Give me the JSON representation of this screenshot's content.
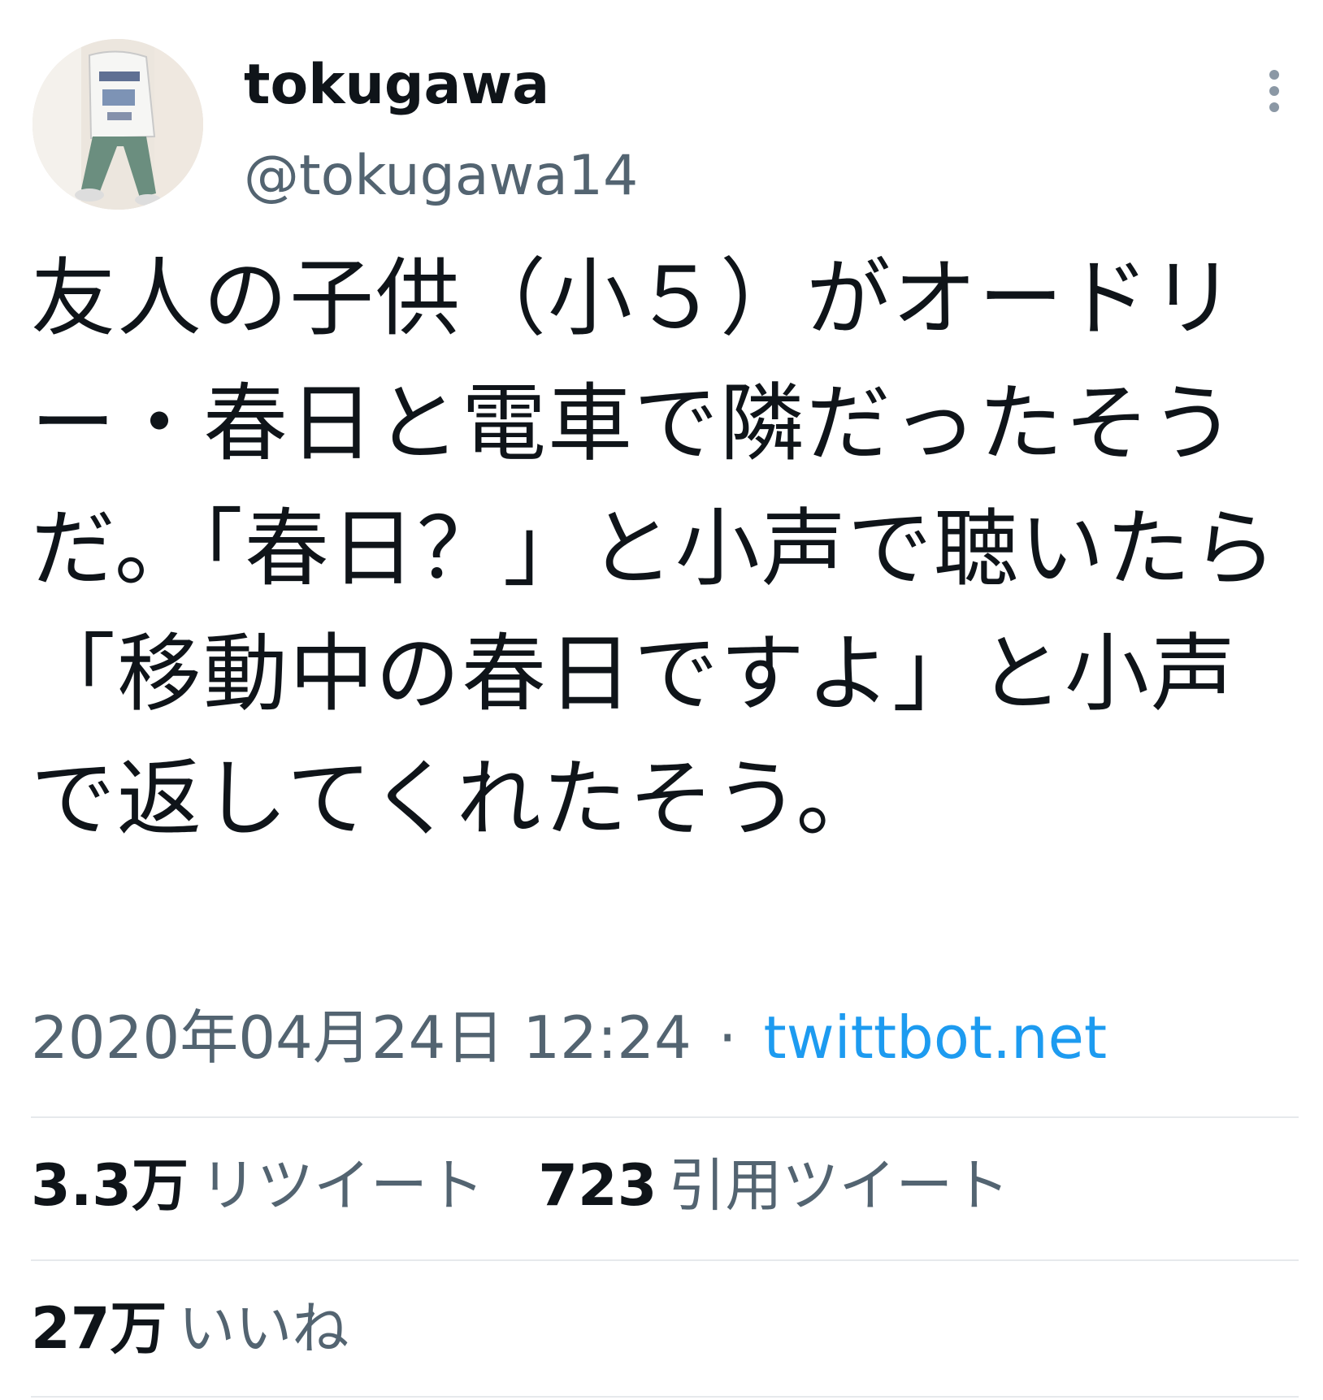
{
  "user": {
    "display_name": "tokugawa",
    "handle": "@tokugawa14"
  },
  "tweet": {
    "text": "友人の子供（小５）がオードリー・春日と電車で隣だったそうだ。「春日？」と小声で聴いたら「移動中の春日ですよ」と小声で返してくれたそう。",
    "timestamp": "2020年04月24日 12:24",
    "separator": "·",
    "source": "twittbot.net"
  },
  "stats": {
    "retweets_count": "3.3万",
    "retweets_label": "リツイート",
    "quotes_count": "723",
    "quotes_label": "引用ツイート",
    "likes_count": "27万",
    "likes_label": "いいね"
  },
  "icons": {
    "more": "more-vertical-icon"
  },
  "colors": {
    "text_primary": "#0f1419",
    "text_secondary": "#536471",
    "link": "#1d9bf0",
    "divider": "#e6e9ec"
  }
}
